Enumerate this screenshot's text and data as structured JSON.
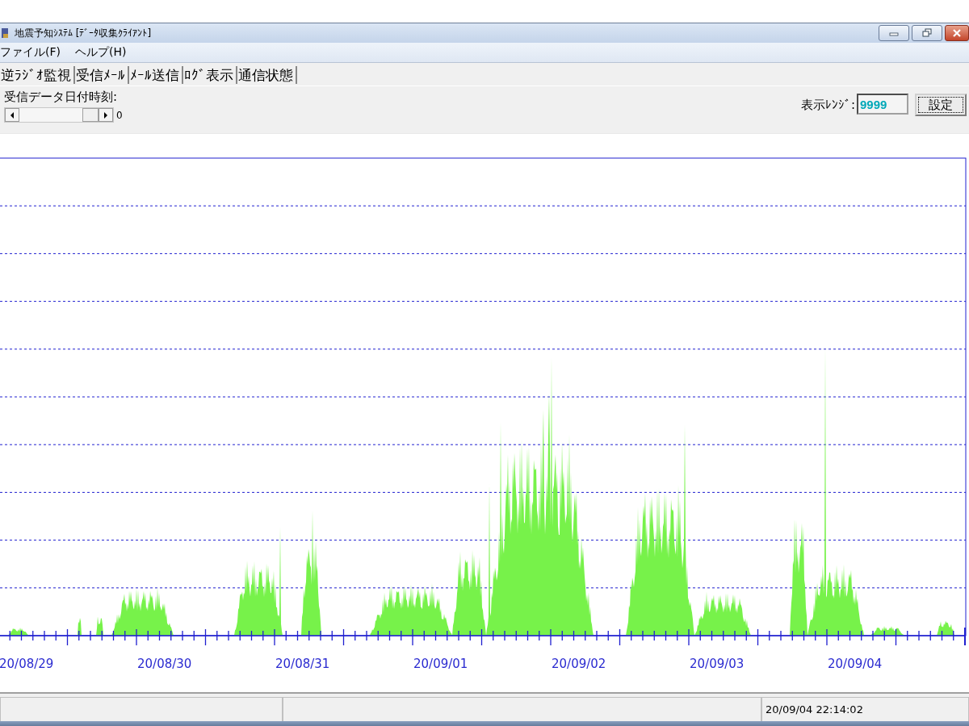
{
  "window": {
    "title": "地震予知ｼｽﾃﾑ [ﾃﾞｰﾀ収集ｸﾗｲｱﾝﾄ]"
  },
  "menu": [
    "ファイル(F)",
    "ヘルプ(H)"
  ],
  "tabs": [
    "逆ﾗｼﾞｵ監視",
    "受信ﾒｰﾙ",
    "ﾒｰﾙ送信",
    "ﾛｸﾞ表示",
    "通信状態"
  ],
  "date_control": {
    "label": "受信データ日付時刻:",
    "reading": "0"
  },
  "range": {
    "label": "表示ﾚﾝｼﾞ:",
    "value": "9999",
    "button": "設定"
  },
  "chart": {
    "x_labels": [
      "20/08/29",
      "20/08/30",
      "20/08/31",
      "20/09/01",
      "20/09/02",
      "20/09/03",
      "20/09/04"
    ]
  },
  "status_bar": {
    "timestamp": "20/09/04 22:14:02"
  }
}
